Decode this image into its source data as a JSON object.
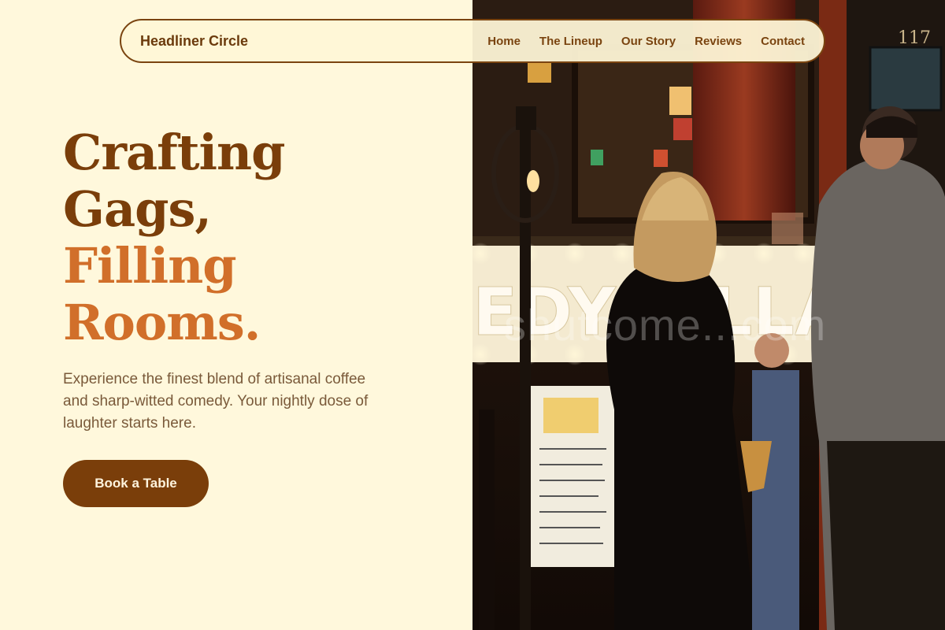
{
  "nav": {
    "brand": "Headliner Circle",
    "links": [
      {
        "label": "Home"
      },
      {
        "label": "The Lineup"
      },
      {
        "label": "Our Story"
      },
      {
        "label": "Reviews"
      },
      {
        "label": "Contact"
      }
    ]
  },
  "hero": {
    "headline": {
      "line1": "Crafting",
      "line2": "Gags,",
      "line3": "Filling",
      "line4": "Rooms."
    },
    "subtitle": "Experience the finest blend of artisanal coffee and sharp-witted comedy. Your nightly dose of laughter starts here.",
    "cta_label": "Book a Table"
  },
  "photo": {
    "watermark": "shutcome...com",
    "sign_text": "EDY C LLAR",
    "door_number": "117"
  },
  "colors": {
    "background": "#fff8dc",
    "brand_brown": "#7a3e0a",
    "accent_orange": "#d16f2a",
    "body_text": "#7a5a3a"
  }
}
